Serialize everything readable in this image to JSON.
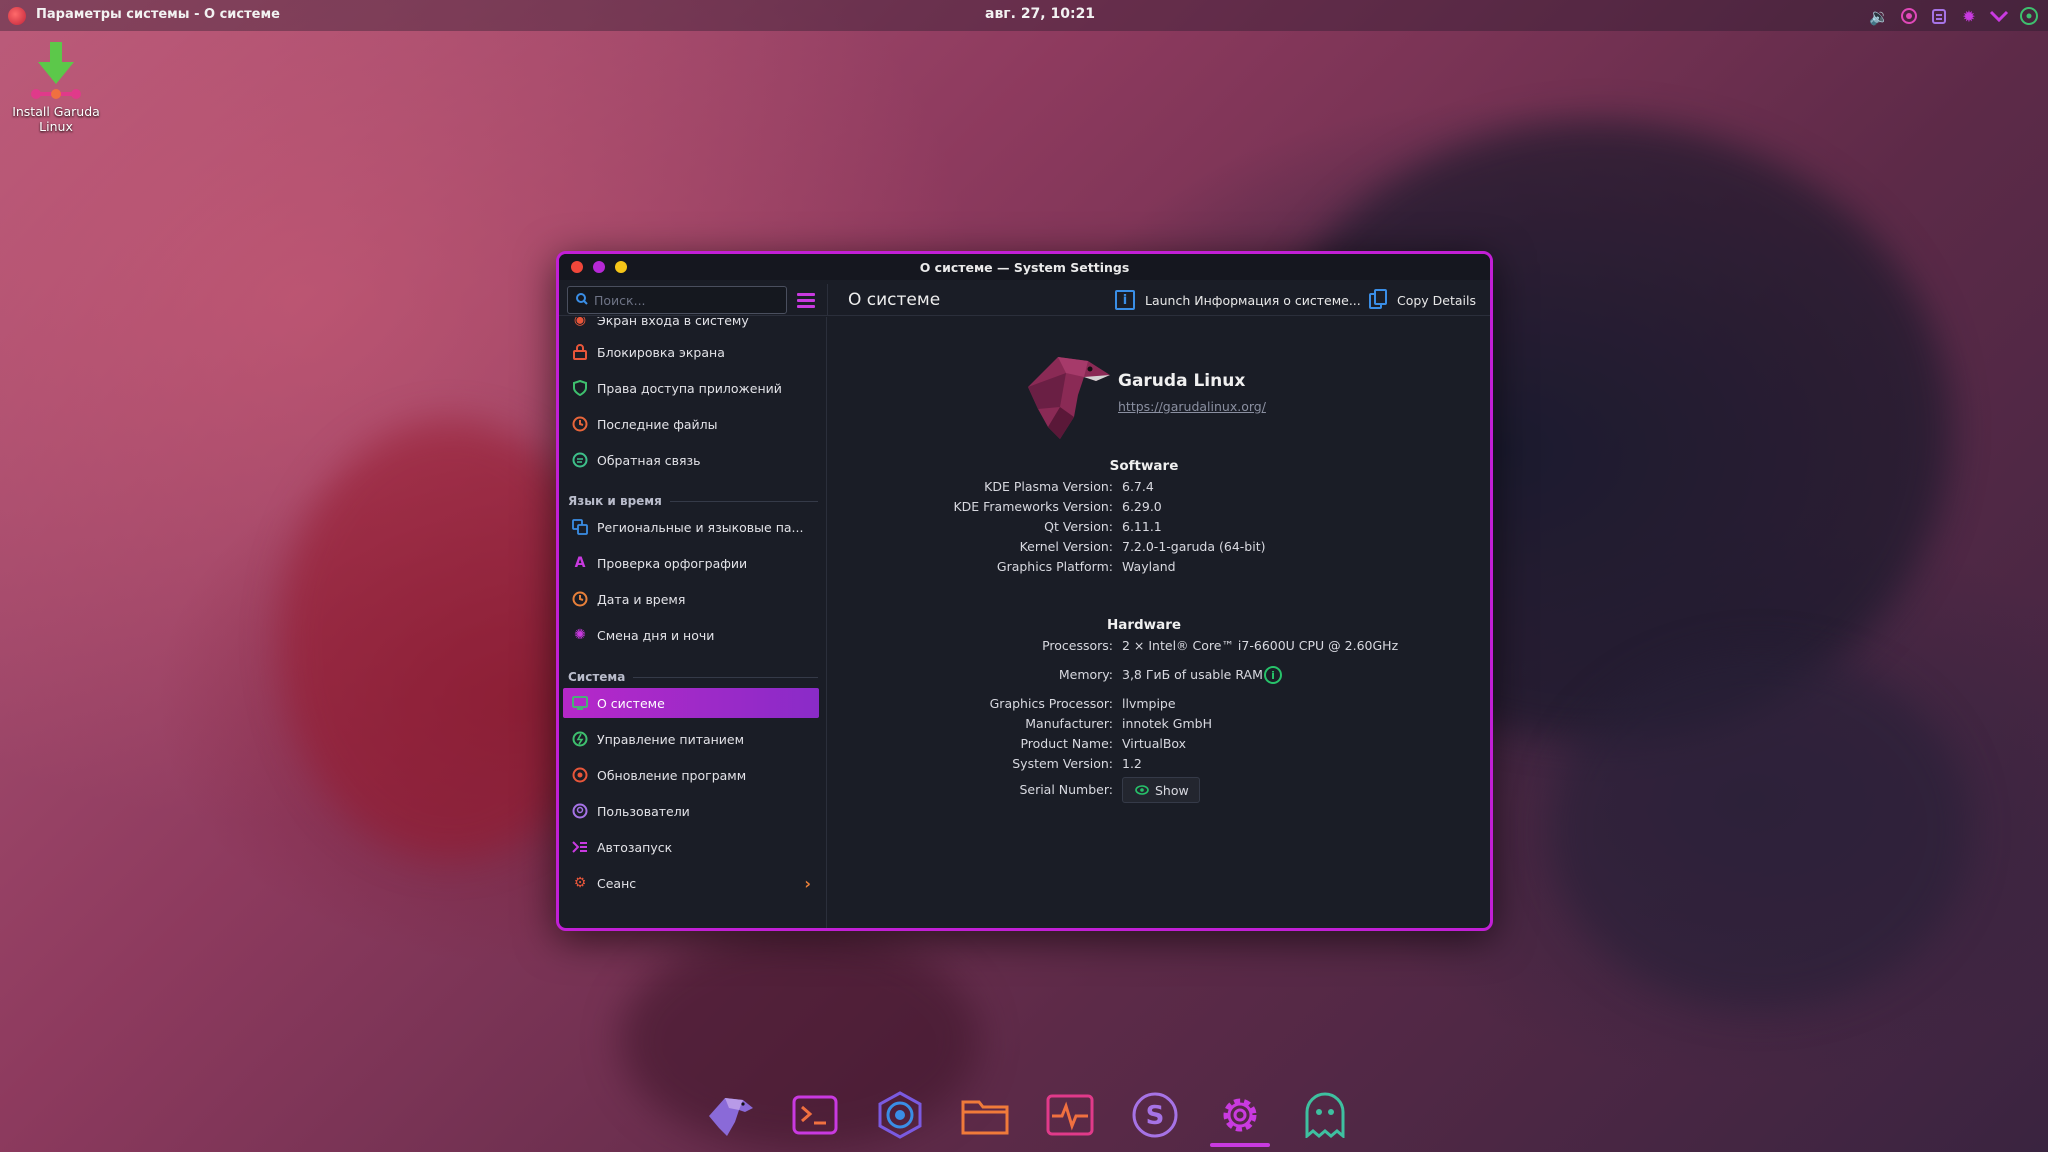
{
  "top_panel": {
    "window_title": "Параметры системы - О системе",
    "clock": "авг. 27, 10:21",
    "tray_icons": [
      "volume-icon",
      "spotify-like-icon",
      "clipboard-icon",
      "brightness-icon",
      "chevron-down-icon",
      "network-icon"
    ]
  },
  "desktop": {
    "install_label": "Install Garuda Linux"
  },
  "window": {
    "title": "О системе — System Settings",
    "search_placeholder": "Поиск...",
    "page_title": "О системе",
    "launch_label": "Launch Информация о системе...",
    "copy_label": "Copy Details"
  },
  "sidebar": {
    "partial_item": "Экран входа в систему",
    "items_a": [
      {
        "label": "Блокировка экрана",
        "icon": "lock-icon",
        "color": "#e8563a"
      },
      {
        "label": "Права доступа приложений",
        "icon": "shield-icon",
        "color": "#3ec06e"
      },
      {
        "label": "Последние файлы",
        "icon": "clock-icon",
        "color": "#e8653a"
      },
      {
        "label": "Обратная связь",
        "icon": "chat-icon",
        "color": "#3ec08a"
      }
    ],
    "section_lang": "Язык и время",
    "items_b": [
      {
        "label": "Региональные и языковые па...",
        "icon": "translate-icon",
        "color": "#3a8ee6"
      },
      {
        "label": "Проверка орфографии",
        "icon": "spellcheck-icon",
        "color": "#c93ae0"
      },
      {
        "label": "Дата и время",
        "icon": "clock-icon",
        "color": "#e8803a"
      },
      {
        "label": "Смена дня и ночи",
        "icon": "sun-icon",
        "color": "#c93ae0"
      }
    ],
    "section_system": "Система",
    "items_c": [
      {
        "label": "О системе",
        "icon": "computer-icon",
        "color": "#3ec06e",
        "active": true
      },
      {
        "label": "Управление питанием",
        "icon": "power-icon",
        "color": "#3ec06e"
      },
      {
        "label": "Обновление программ",
        "icon": "update-icon",
        "color": "#e8563a"
      },
      {
        "label": "Пользователи",
        "icon": "user-icon",
        "color": "#a673e6"
      },
      {
        "label": "Автозапуск",
        "icon": "autostart-icon",
        "color": "#c93ae0"
      },
      {
        "label": "Сеанс",
        "icon": "session-gear-icon",
        "color": "#e8563a",
        "has_arrow": true
      }
    ]
  },
  "about": {
    "distro_name": "Garuda Linux",
    "distro_url": "https://garudalinux.org/",
    "software_heading": "Software",
    "software": [
      {
        "key": "KDE Plasma Version:",
        "value": "6.7.4"
      },
      {
        "key": "KDE Frameworks Version:",
        "value": "6.29.0"
      },
      {
        "key": "Qt Version:",
        "value": "6.11.1"
      },
      {
        "key": "Kernel Version:",
        "value": "7.2.0-1-garuda (64-bit)"
      },
      {
        "key": "Graphics Platform:",
        "value": "Wayland"
      }
    ],
    "hardware_heading": "Hardware",
    "hardware": [
      {
        "key": "Processors:",
        "value": "2 × Intel® Core™ i7-6600U CPU @ 2.60GHz"
      },
      {
        "key": "Memory:",
        "value": "3,8 ГиБ of usable RAM"
      },
      {
        "key": "Graphics Processor:",
        "value": "llvmpipe"
      },
      {
        "key": "Manufacturer:",
        "value": "innotek GmbH"
      },
      {
        "key": "Product Name:",
        "value": "VirtualBox"
      },
      {
        "key": "System Version:",
        "value": "1.2"
      }
    ],
    "serial_key": "Serial Number:",
    "serial_button": "Show"
  },
  "dock": {
    "items": [
      "garuda-eagle-icon",
      "terminal-icon",
      "browser-icon",
      "folder-icon",
      "system-monitor-icon",
      "s-app-icon",
      "settings-gear-icon",
      "ghost-icon"
    ],
    "active": "settings-gear-icon"
  }
}
